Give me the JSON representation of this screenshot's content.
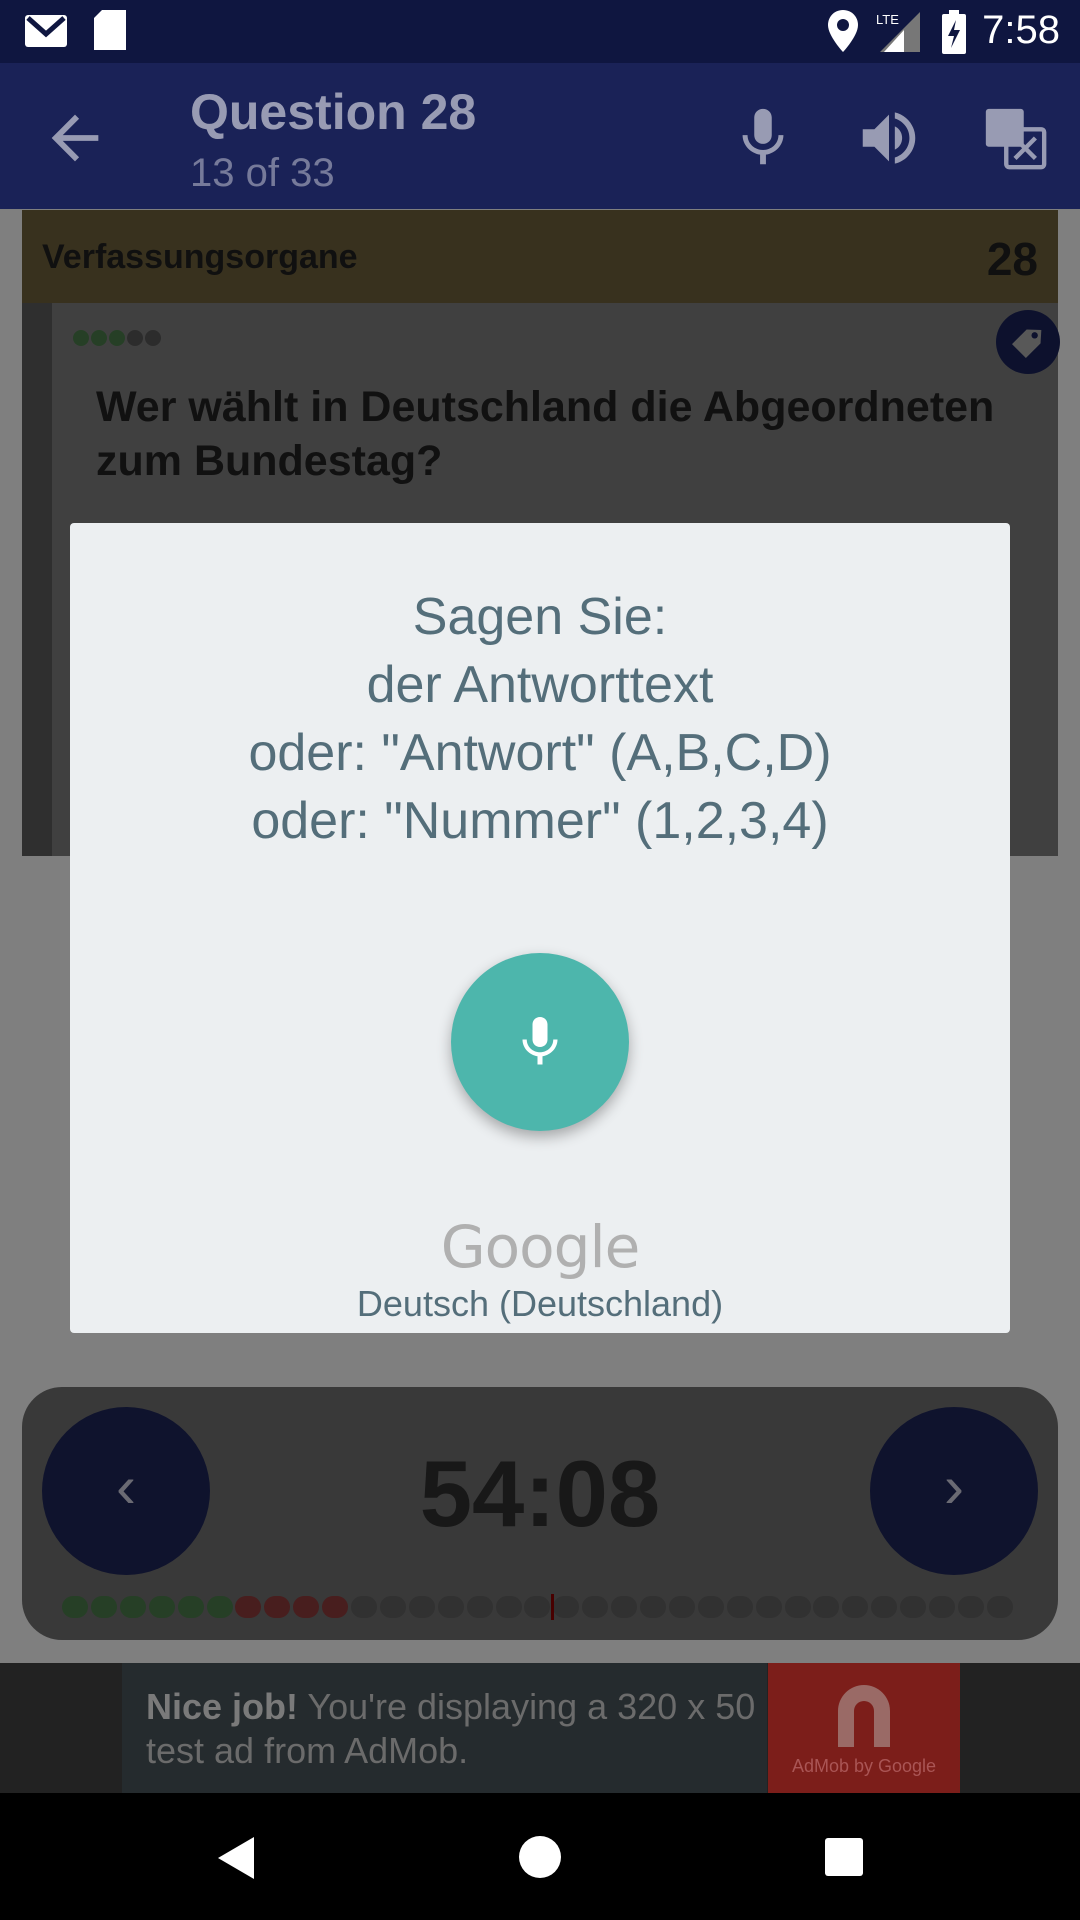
{
  "status_bar": {
    "time": "7:58",
    "network": "LTE"
  },
  "app_bar": {
    "title": "Question 28",
    "subtitle": "13 of 33",
    "icons": [
      "back-arrow-icon",
      "microphone-icon",
      "volume-icon",
      "translate-icon"
    ]
  },
  "category": {
    "name": "Verfassungsorgane",
    "number": "28"
  },
  "question": {
    "text": "Wer wählt in Deutschland die Abgeordneten zum Bundestag?"
  },
  "dialog": {
    "prompt_lines": [
      "Sagen Sie:",
      "der Antworttext",
      "oder: \"Antwort\" (A,B,C,D)",
      "oder: \"Nummer\" (1,2,3,4)"
    ],
    "brand": "Google",
    "language": "Deutsch (Deutschland)"
  },
  "navigation": {
    "timer": "54:08",
    "prev_label": "‹",
    "next_label": "›"
  },
  "progress": {
    "total": 33,
    "current": 17,
    "green": 6,
    "red": 4
  },
  "ad": {
    "bold": "Nice job!",
    "text": " You're displaying a 320 x 50 test ad from AdMob.",
    "logo_text": "AdMob by Google"
  },
  "colors": {
    "primary": "#1a2257",
    "accent": "#4db6ac",
    "green": "#4a7a4a",
    "red": "#8a3a3a"
  }
}
